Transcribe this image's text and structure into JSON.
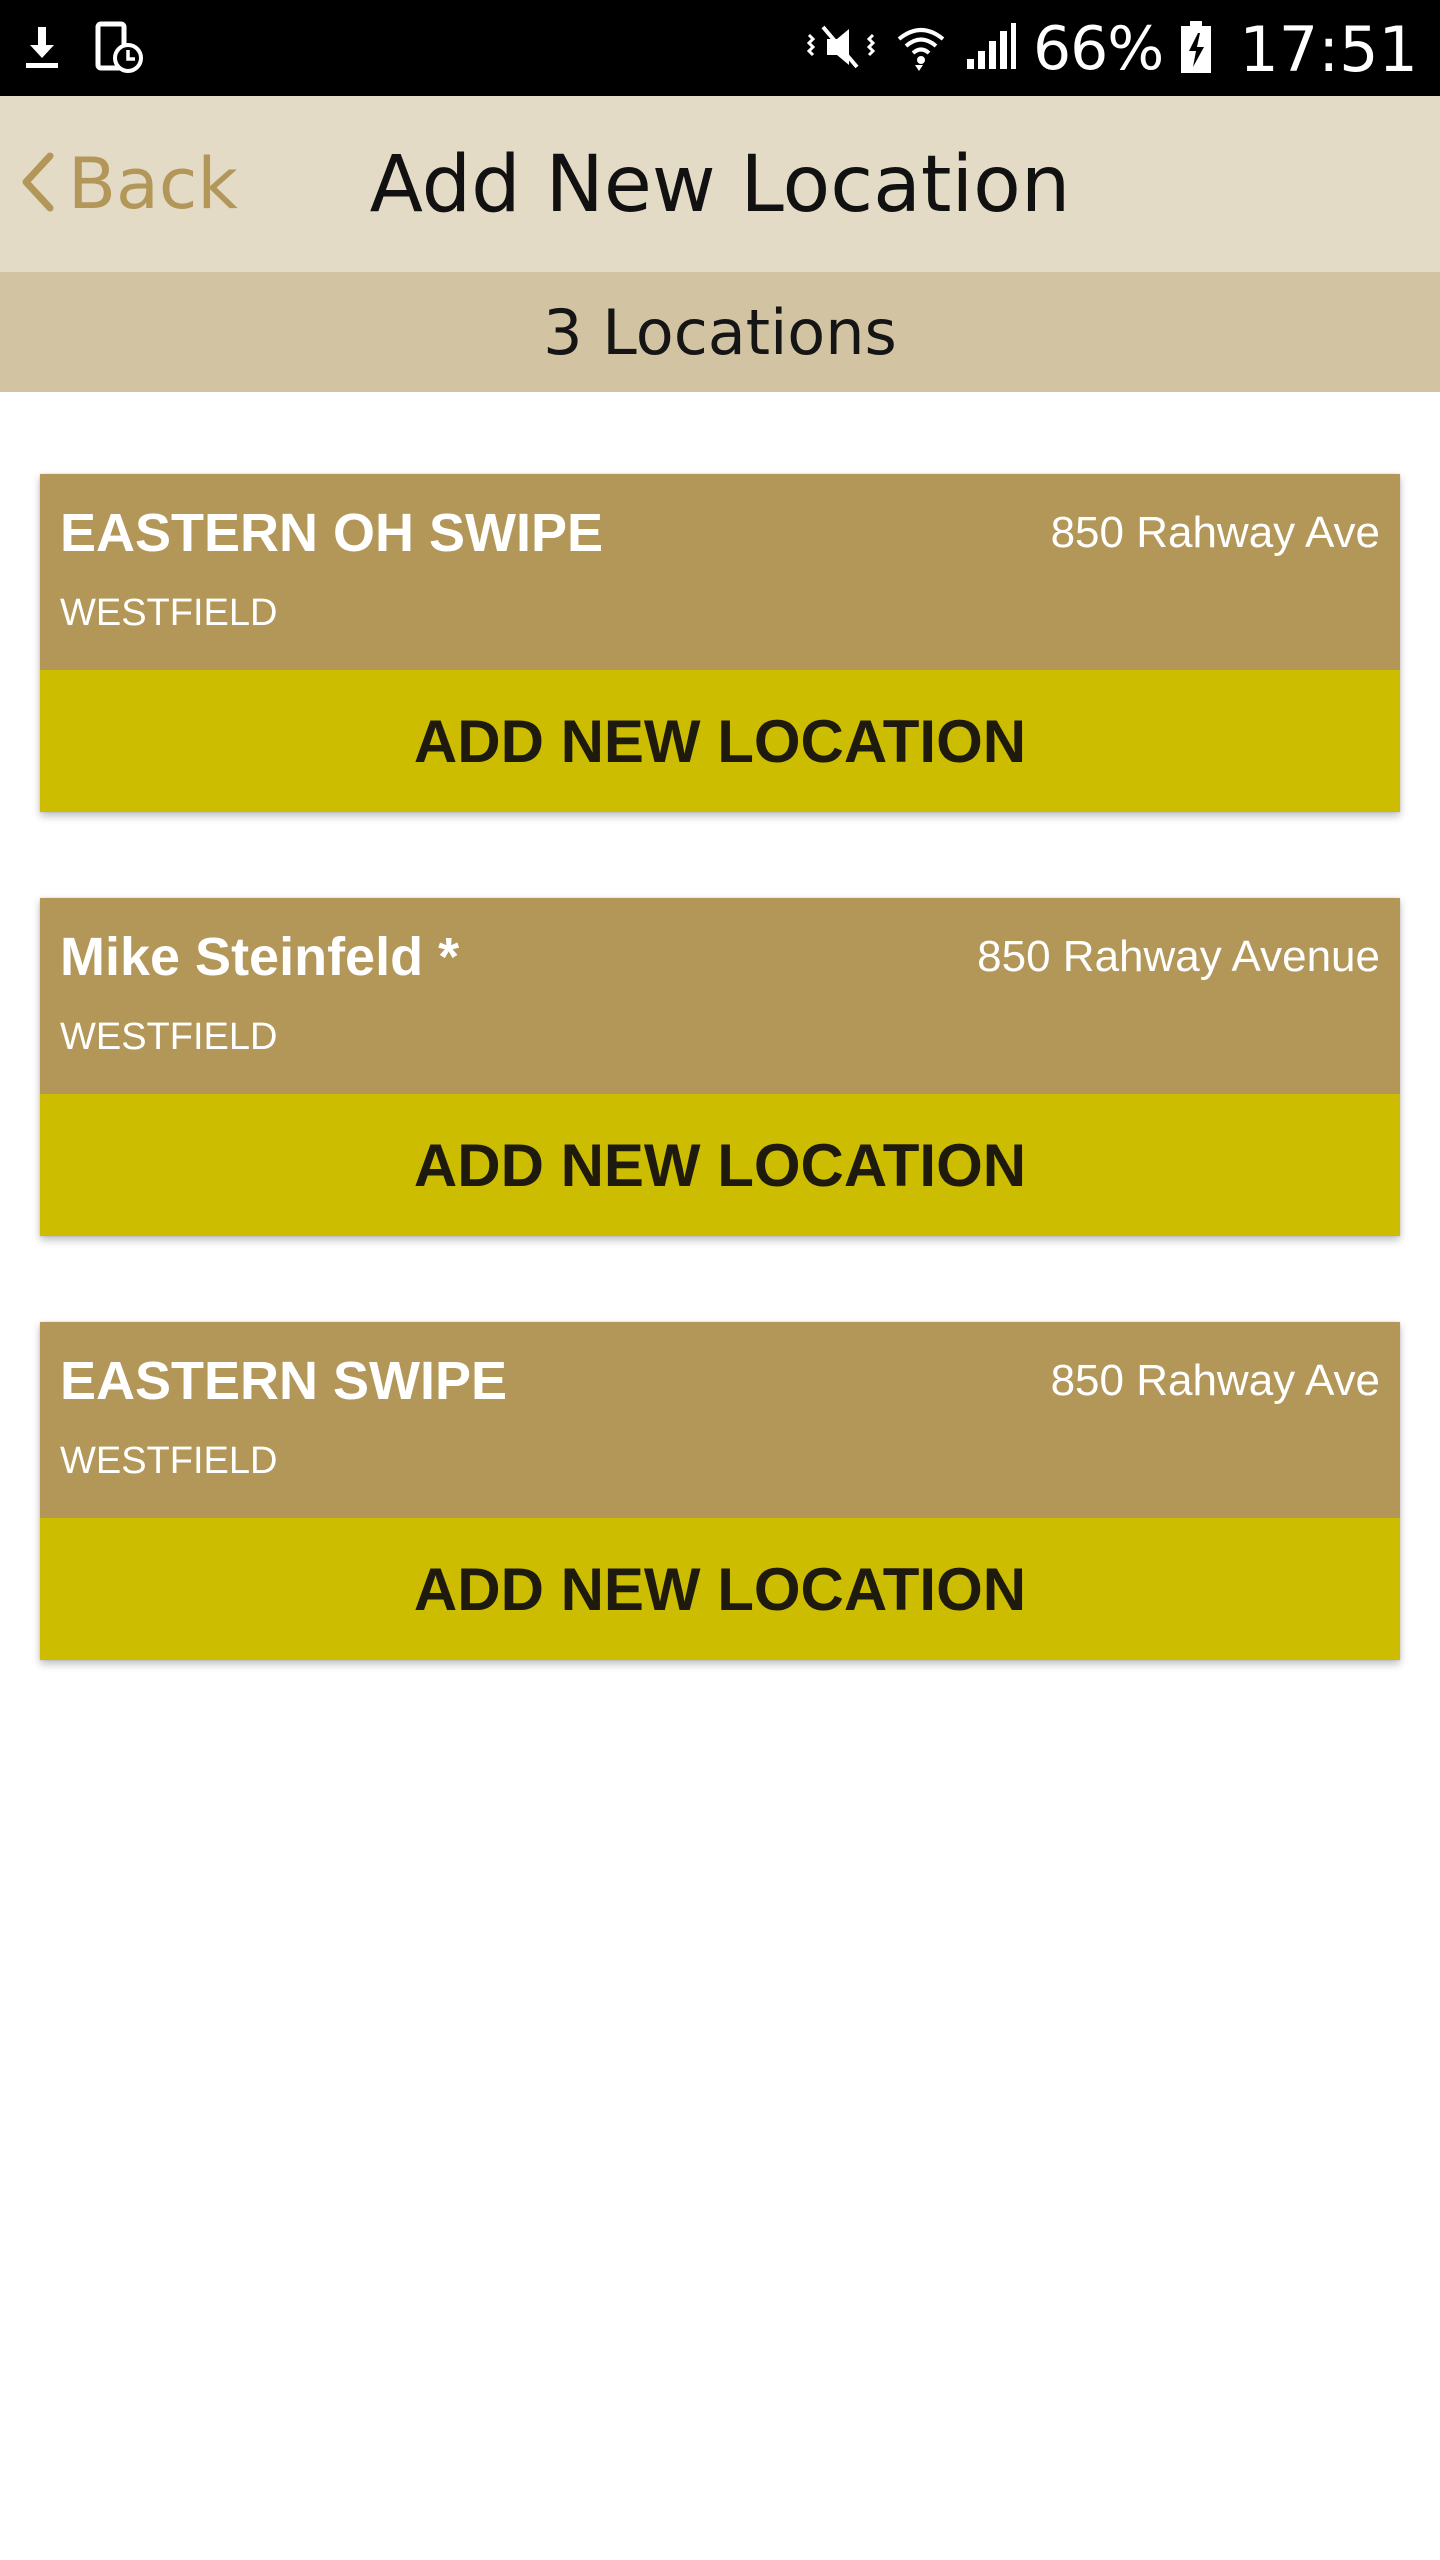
{
  "status_bar": {
    "battery_percent": "66%",
    "time": "17:51",
    "left_icons": [
      "download-icon",
      "device-alarm-icon"
    ],
    "right_icons": [
      "mute-vibrate-icon",
      "wifi-icon",
      "signal-icon",
      "battery-charging-icon"
    ]
  },
  "header": {
    "back_label": "Back",
    "title": "Add New Location"
  },
  "subheader": {
    "text": "3 Locations"
  },
  "locations": [
    {
      "name": "EASTERN OH SWIPE",
      "address": "850 Rahway Ave",
      "city": "WESTFIELD",
      "action_label": "ADD NEW LOCATION"
    },
    {
      "name": "Mike Steinfeld *",
      "address": "850 Rahway Avenue",
      "city": "WESTFIELD",
      "action_label": "ADD NEW LOCATION"
    },
    {
      "name": "EASTERN SWIPE",
      "address": "850 Rahway Ave",
      "city": "WESTFIELD",
      "action_label": "ADD NEW LOCATION"
    }
  ],
  "colors": {
    "status_bar": "#000000",
    "header_bg": "#e3dbc6",
    "subheader_bg": "#d2c4a2",
    "accent": "#b39759",
    "card_bg": "#b39759",
    "action_bg": "#cdbd00",
    "action_text": "#1f1a0e"
  }
}
